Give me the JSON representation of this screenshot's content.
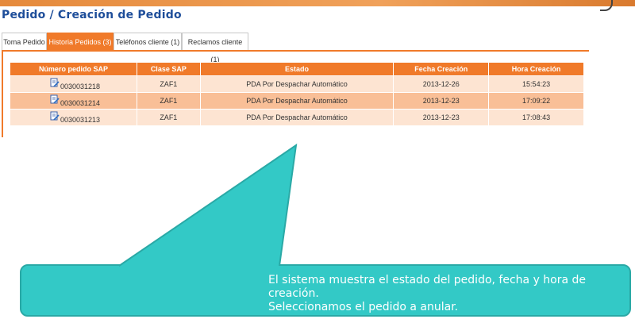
{
  "page": {
    "title": "Pedido / Creación de Pedido"
  },
  "tabs": [
    {
      "label": "Toma Pedido",
      "active": false
    },
    {
      "label": "Historia Pedidos (3)",
      "active": true
    },
    {
      "label": "Teléfonos cliente (1)",
      "active": false
    },
    {
      "label": "Reclamos cliente (1)",
      "active": false
    }
  ],
  "table": {
    "headers": [
      "Número pedido SAP",
      "Clase SAP",
      "Estado",
      "Fecha Creación",
      "Hora Creación"
    ],
    "rows": [
      {
        "order": "0030031218",
        "clase": "ZAF1",
        "estado": "PDA Por Despachar Automático",
        "fecha": "2013-12-26",
        "hora": "15:54:23"
      },
      {
        "order": "0030031214",
        "clase": "ZAF1",
        "estado": "PDA Por Despachar Automático",
        "fecha": "2013-12-23",
        "hora": "17:09:22"
      },
      {
        "order": "0030031213",
        "clase": "ZAF1",
        "estado": "PDA Por Despachar Automático",
        "fecha": "2013-12-23",
        "hora": "17:08:43"
      }
    ]
  },
  "callout": {
    "line1": "El sistema muestra el estado del pedido, fecha y hora de creación.",
    "line2": "Seleccionamos el pedido a anular."
  },
  "icons": {
    "row_icon": "edit-document-icon"
  },
  "colors": {
    "accent": "#f07a2a",
    "title": "#1e4e9a",
    "row_light": "#fde4d2",
    "row_dark": "#f9bf97",
    "callout": "#33c9c6"
  }
}
